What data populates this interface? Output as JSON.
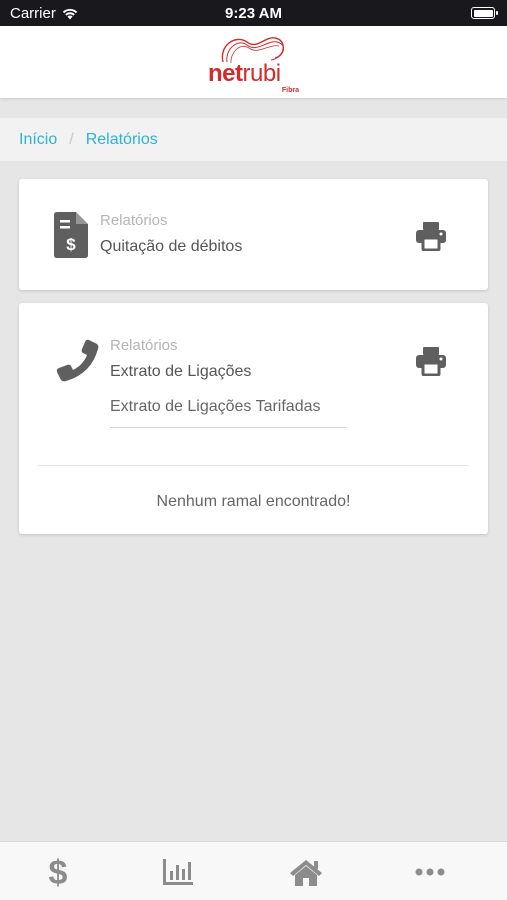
{
  "status_bar": {
    "carrier": "Carrier",
    "time": "9:23 AM"
  },
  "brand": {
    "name_part1": "net",
    "name_part2": "rubi",
    "tagline": "Fibra",
    "color": "#d62a2a"
  },
  "breadcrumb": {
    "home": "Início",
    "separator": "/",
    "current": "Relatórios"
  },
  "reports": [
    {
      "kicker": "Relatórios",
      "title": "Quitação de débitos",
      "icon": "invoice-dollar-icon",
      "action_icon": "printer-icon"
    },
    {
      "kicker": "Relatórios",
      "title": "Extrato de Ligações",
      "icon": "phone-icon",
      "action_icon": "printer-icon",
      "select_value": "Extrato de Ligações Tarifadas",
      "empty_message": "Nenhum ramal encontrado!"
    }
  ],
  "tabbar": {
    "items": [
      "dollar-icon",
      "bar-chart-icon",
      "home-icon",
      "more-icon"
    ]
  },
  "colors": {
    "accent": "#2bb3d6",
    "icon": "#5f5f5f"
  }
}
